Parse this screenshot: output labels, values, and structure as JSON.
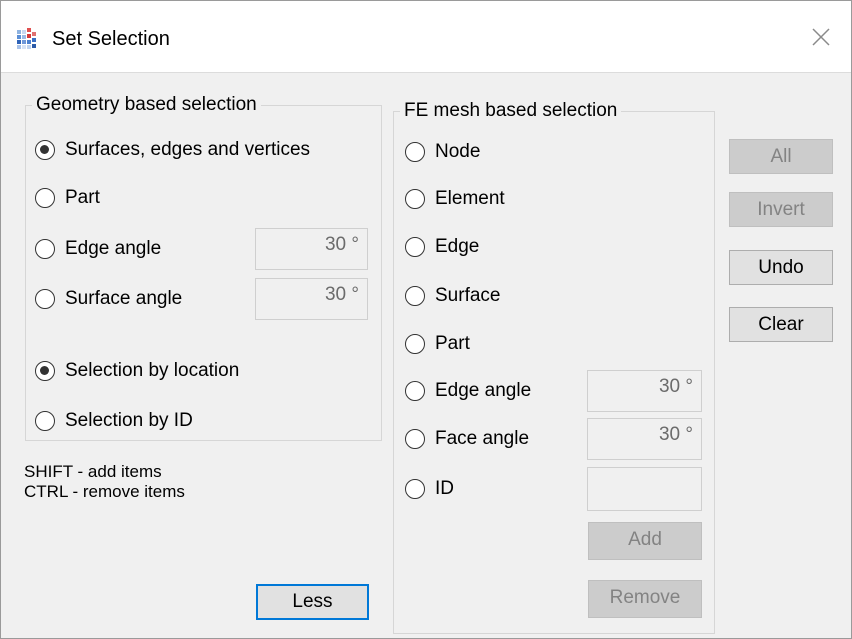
{
  "window": {
    "title": "Set Selection"
  },
  "geometry": {
    "legend": "Geometry based selection",
    "options": [
      {
        "label": "Surfaces, edges and vertices",
        "checked": true
      },
      {
        "label": "Part",
        "checked": false
      },
      {
        "label": "Edge angle",
        "checked": false
      },
      {
        "label": "Surface angle",
        "checked": false
      }
    ],
    "edge_angle_value": "30 °",
    "surface_angle_value": "30 °",
    "mode_options": [
      {
        "label": "Selection by location",
        "checked": true
      },
      {
        "label": "Selection by ID",
        "checked": false
      }
    ]
  },
  "hints": {
    "shift": "SHIFT - add items",
    "ctrl": "CTRL - remove items"
  },
  "fe": {
    "legend": "FE mesh based selection",
    "options": [
      {
        "label": "Node",
        "checked": false
      },
      {
        "label": "Element",
        "checked": false
      },
      {
        "label": "Edge",
        "checked": false
      },
      {
        "label": "Surface",
        "checked": false
      },
      {
        "label": "Part",
        "checked": false
      },
      {
        "label": "Edge angle",
        "checked": false
      },
      {
        "label": "Face angle",
        "checked": false
      },
      {
        "label": "ID",
        "checked": false
      }
    ],
    "edge_angle_value": "30 °",
    "face_angle_value": "30 °",
    "id_value": "",
    "add_label": "Add",
    "remove_label": "Remove"
  },
  "buttons": {
    "all": "All",
    "invert": "Invert",
    "undo": "Undo",
    "clear": "Clear",
    "less": "Less"
  }
}
